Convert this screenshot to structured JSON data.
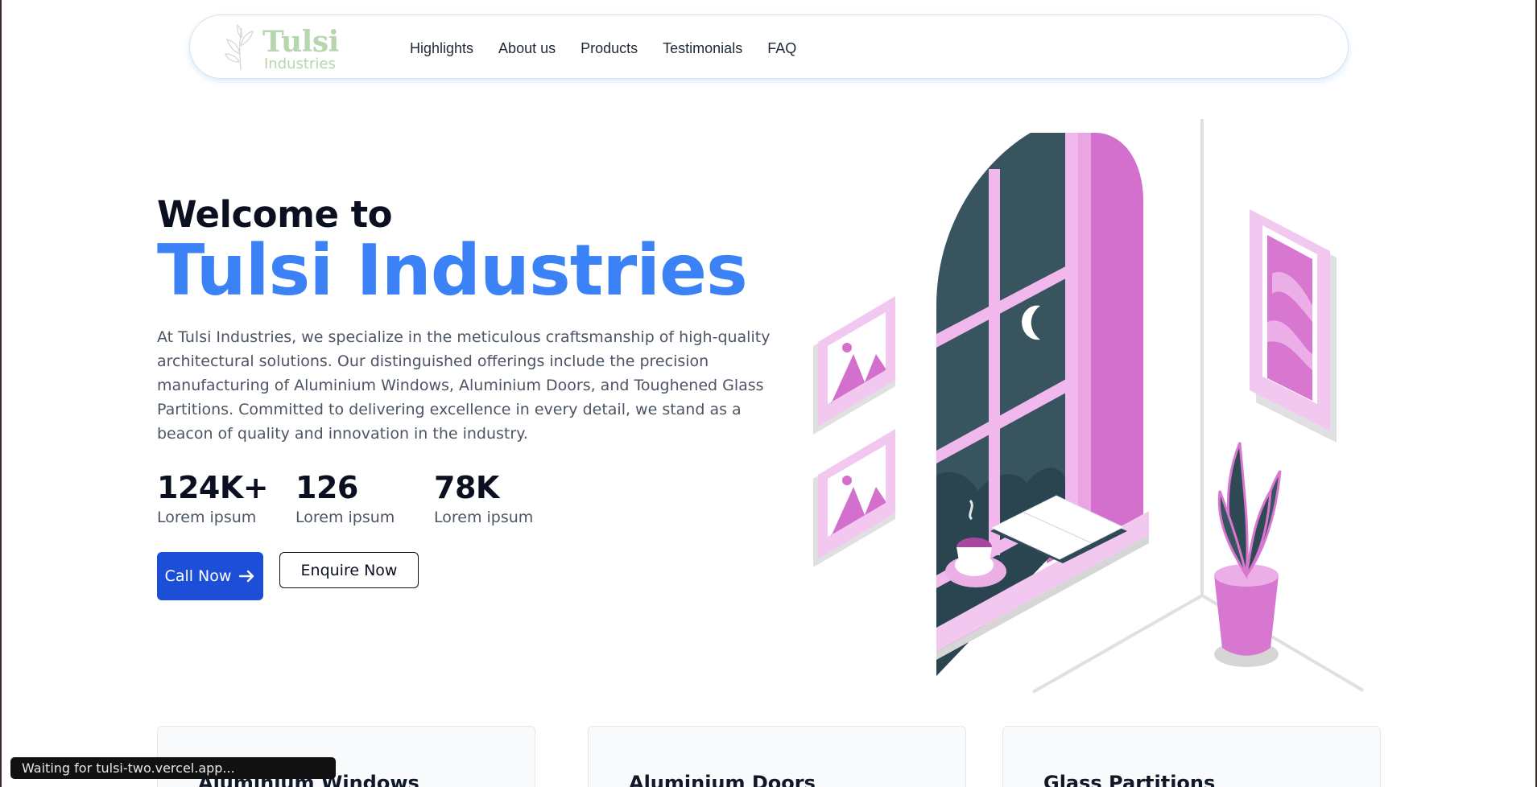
{
  "browser": {
    "status_text": "Waiting for tulsi-two.vercel.app..."
  },
  "nav": {
    "logo_title": "Tulsi",
    "logo_subtitle": "Industries",
    "links": [
      "Highlights",
      "About us",
      "Products",
      "Testimonials",
      "FAQ"
    ]
  },
  "hero": {
    "welcome": "Welcome to",
    "brand": "Tulsi Industries",
    "description": "At Tulsi Industries, we specialize in the meticulous craftsmanship of high-quality architectural solutions. Our distinguished offerings include the precision manufacturing of Aluminium Windows, Aluminium Doors, and Toughened Glass Partitions. Committed to delivering excellence in every detail, we stand as a beacon of quality and innovation in the industry.",
    "stats": [
      {
        "value": "124K+",
        "label": "Lorem ipsum"
      },
      {
        "value": "126",
        "label": "Lorem ipsum"
      },
      {
        "value": "78K",
        "label": "Lorem ipsum"
      }
    ],
    "call_label": "Call Now",
    "call_icon": "arrow-right-icon",
    "enquire_label": "Enquire Now"
  },
  "products": {
    "cards": [
      {
        "title": "Aluminium Windows"
      },
      {
        "title": "Aluminium Doors"
      },
      {
        "title": "Glass Partitions"
      }
    ]
  },
  "colors": {
    "brand_blue": "#3b82f6",
    "button_blue": "#1d4ed8",
    "logo_green": "#b7d6ad",
    "illustration_pink": "#d877d0",
    "illustration_dark": "#37545f"
  }
}
